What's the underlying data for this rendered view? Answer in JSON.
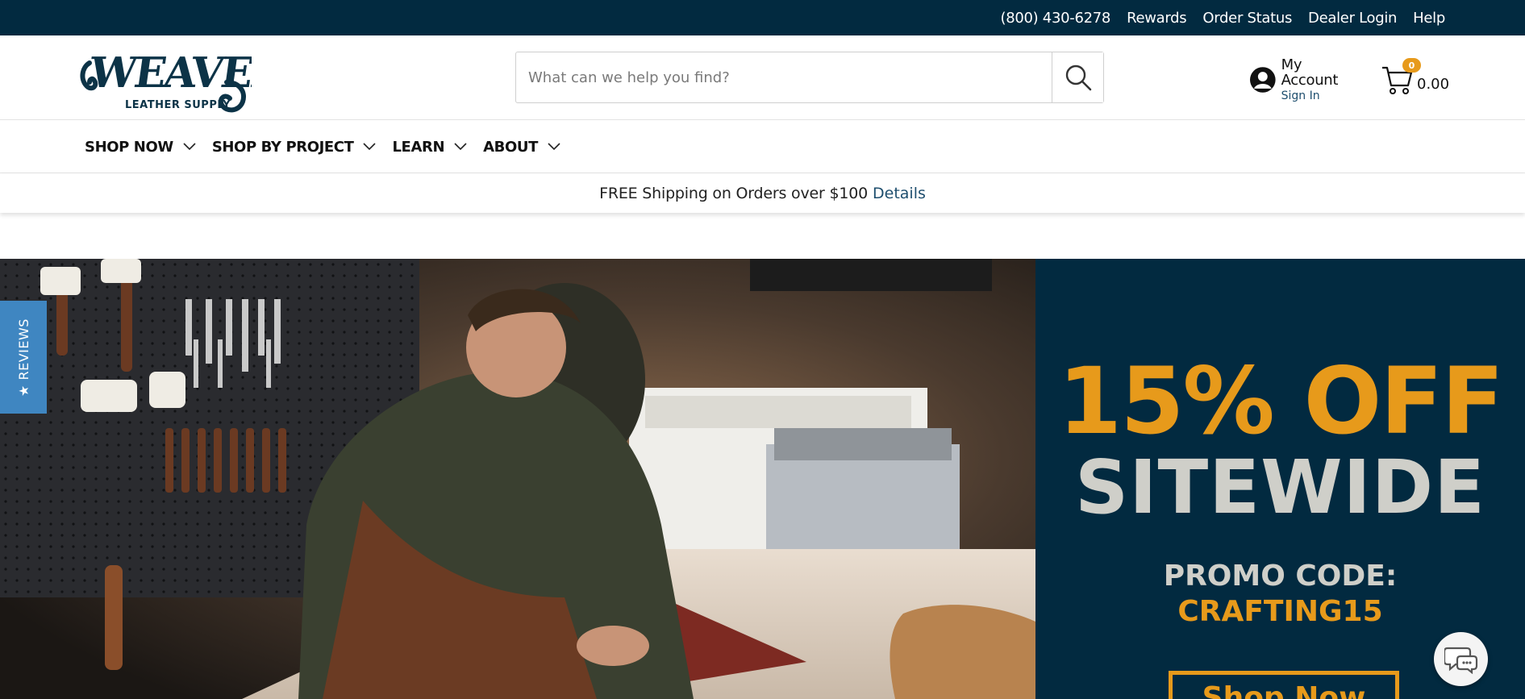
{
  "topbar": {
    "links": [
      {
        "label": "(800) 430-6278"
      },
      {
        "label": "Rewards"
      },
      {
        "label": "Order Status"
      },
      {
        "label": "Dealer Login"
      },
      {
        "label": "Help"
      }
    ]
  },
  "header": {
    "logo": {
      "word": "WEAVER",
      "sub": "LEATHER SUPPLY"
    },
    "search": {
      "placeholder": "What can we help you find?",
      "value": ""
    },
    "account": {
      "title": "My Account",
      "sub": "Sign In"
    },
    "cart": {
      "count": "0",
      "total": "0.00"
    }
  },
  "nav": {
    "items": [
      {
        "label": "SHOP NOW"
      },
      {
        "label": "SHOP BY PROJECT"
      },
      {
        "label": "LEARN"
      },
      {
        "label": "ABOUT"
      }
    ]
  },
  "promo_bar": {
    "text": "FREE Shipping on Orders over $100",
    "link": "Details"
  },
  "hero": {
    "offer_line1": "15% OFF",
    "offer_line2": "SITEWIDE",
    "promo_label": "PROMO CODE:",
    "promo_code": "CRAFTING15",
    "cta": "Shop Now"
  },
  "reviews_tab": {
    "label": "★ REVIEWS"
  },
  "colors": {
    "navy": "#022a40",
    "accent": "#e79a1b",
    "reviews_blue": "#3f86c1"
  },
  "icons": [
    "search-icon",
    "user-icon",
    "cart-icon",
    "chevron-down-icon",
    "chat-icon"
  ]
}
